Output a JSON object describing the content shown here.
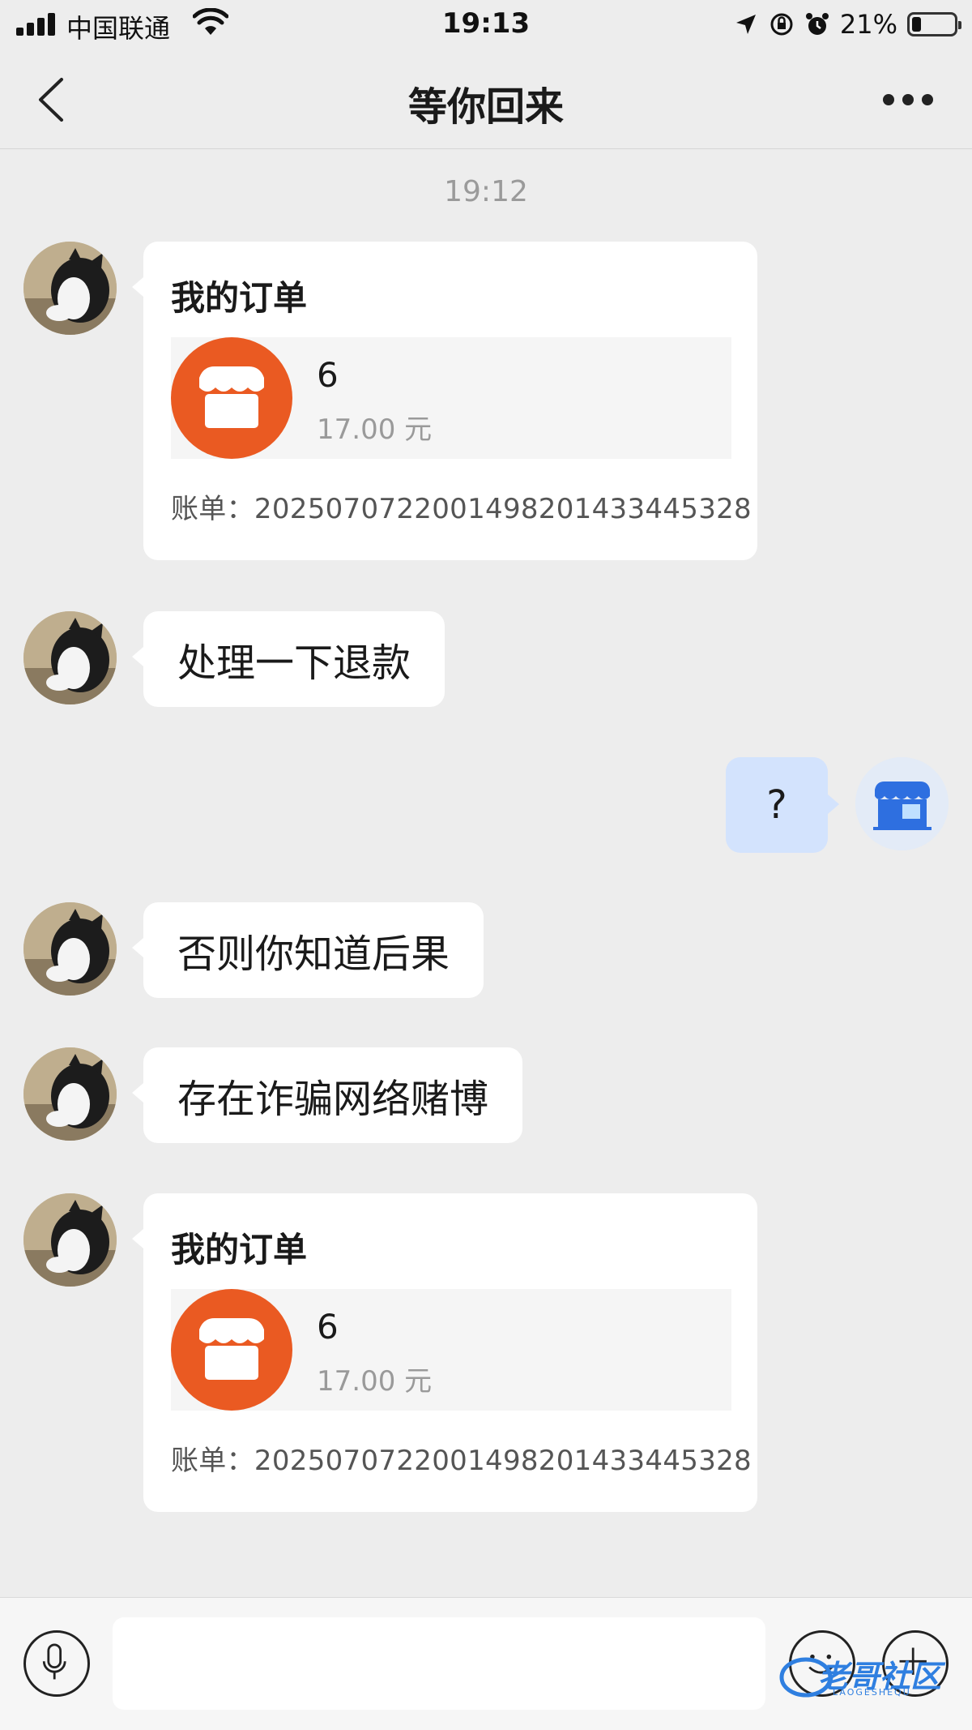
{
  "status_bar": {
    "carrier": "中国联通",
    "time": "19:13",
    "battery": "21%",
    "battery_level": 0.21,
    "icons": [
      "signal-icon",
      "wifi-icon",
      "location-arrow-icon",
      "orientation-lock-icon",
      "alarm-icon",
      "battery-icon"
    ]
  },
  "nav": {
    "title": "等你回来",
    "back_icon": "chevron-left-icon",
    "more_icon": "more-dots-icon"
  },
  "chat": {
    "timestamp": "19:12",
    "messages": [
      {
        "side": "left",
        "type": "order",
        "title": "我的订单",
        "item_name": "6",
        "price": "17.00 元",
        "bill": "账单：2025070722001498201433445328"
      },
      {
        "side": "left",
        "type": "text",
        "text": "处理一下退款"
      },
      {
        "side": "right",
        "type": "text",
        "text": "?"
      },
      {
        "side": "left",
        "type": "text",
        "text": "否则你知道后果"
      },
      {
        "side": "left",
        "type": "text",
        "text": "存在诈骗网络赌博"
      },
      {
        "side": "left",
        "type": "order",
        "title": "我的订单",
        "item_name": "6",
        "price": "17.00 元",
        "bill": "账单：2025070722001498201433445328"
      }
    ]
  },
  "input_bar": {
    "message_value": "",
    "voice_icon": "microphone-icon",
    "emoji_icon": "emoji-icon",
    "plus_icon": "plus-icon"
  },
  "watermark": {
    "text": "老哥社区",
    "sub": "LAOGESHEQU"
  },
  "colors": {
    "background": "#ededed",
    "order_orange": "#ea5a22",
    "sent_bubble": "#d3e3fd",
    "timestamp_gray": "#9a9a9a"
  }
}
